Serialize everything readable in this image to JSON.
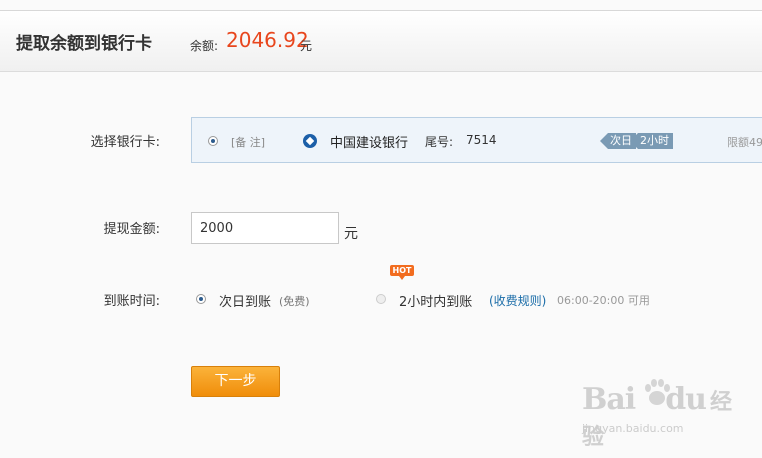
{
  "header": {
    "title": "提取余额到银行卡",
    "balance_label": "余额:",
    "balance_amount": "2046.92",
    "balance_unit": "元"
  },
  "card_select": {
    "label": "选择银行卡:",
    "note": "[备 注]",
    "bank_name": "中国建设银行",
    "tail_label": "尾号:",
    "tail_number": "7514",
    "tags": [
      "次日",
      "2小时"
    ],
    "limit_text": "限额49"
  },
  "amount": {
    "label": "提现金额:",
    "value": "2000",
    "unit": "元"
  },
  "arrival": {
    "label": "到账时间:",
    "options": [
      {
        "text": "次日到账",
        "sub": "(免费)",
        "selected": true
      },
      {
        "text": "2小时内到账",
        "sub": "",
        "selected": false,
        "badge": "HOT"
      }
    ],
    "fee_link": "(收费规则)",
    "hours": "06:00-20:00 可用"
  },
  "actions": {
    "next_label": "下一步"
  },
  "watermark": {
    "main": "Bai",
    "main2": "du",
    "brand": "经验",
    "sub": "jingyan.baidu.com"
  },
  "colors": {
    "accent": "#e8461d",
    "button": "#f39c12",
    "link": "#1a6ca8"
  }
}
